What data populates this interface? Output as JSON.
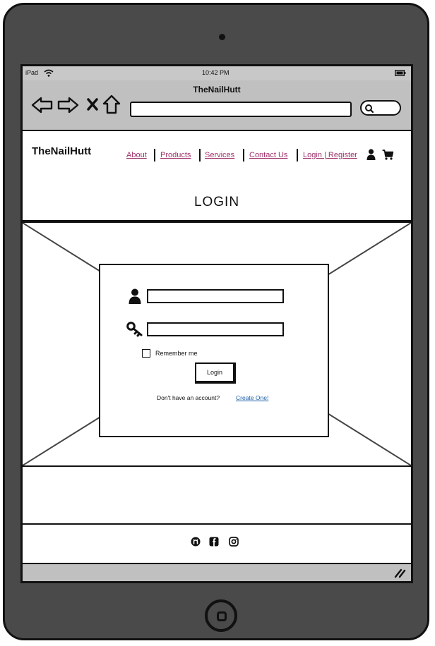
{
  "statusbar": {
    "device": "iPad",
    "time": "10:42 PM"
  },
  "browser": {
    "tab_title": "TheNailHutt",
    "url": ""
  },
  "site": {
    "brand": "TheNailHutt",
    "nav": [
      "About",
      "Products",
      "Services",
      "Contact Us",
      "Login | Register"
    ],
    "page_title": "LOGIN"
  },
  "login": {
    "username_value": "",
    "password_value": "",
    "remember_label": "Remember me",
    "remember_checked": false,
    "login_button": "Login",
    "no_account_text": "Don't have an account?",
    "create_link": "Create One!"
  },
  "footer": {
    "icons": [
      "github-icon",
      "facebook-icon",
      "instagram-icon"
    ]
  },
  "colors": {
    "nav_link": "#a0306a",
    "create_link": "#1a5fa8",
    "chrome": "#c0c0c0",
    "device": "#4a4a4a"
  }
}
